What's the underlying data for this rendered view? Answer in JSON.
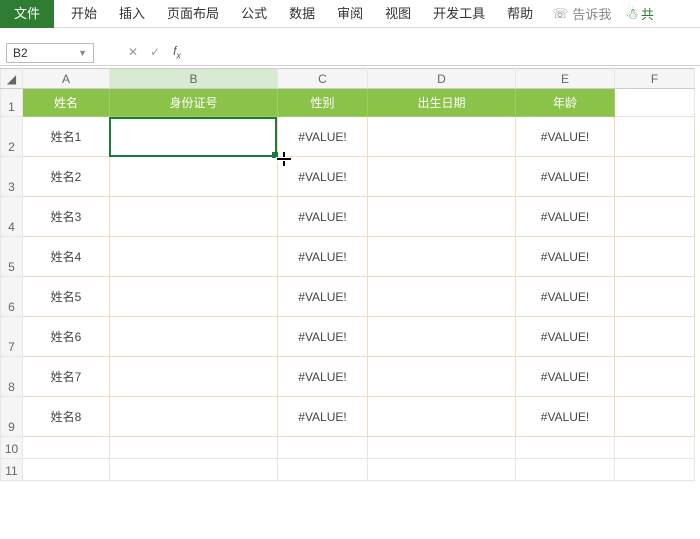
{
  "menu": {
    "file": "文件",
    "tabs": [
      "开始",
      "插入",
      "页面布局",
      "公式",
      "数据",
      "审阅",
      "视图",
      "开发工具",
      "帮助"
    ],
    "tell_me": "告诉我",
    "share": "共"
  },
  "formula_bar": {
    "name_box": "B2"
  },
  "columns": [
    "A",
    "B",
    "C",
    "D",
    "E",
    "F"
  ],
  "headers": {
    "A": "姓名",
    "B": "身份证号",
    "C": "性别",
    "D": "出生日期",
    "E": "年龄"
  },
  "rows": [
    {
      "n": "2",
      "A": "姓名1",
      "B": "",
      "C": "#VALUE!",
      "D": "",
      "E": "#VALUE!"
    },
    {
      "n": "3",
      "A": "姓名2",
      "B": "",
      "C": "#VALUE!",
      "D": "",
      "E": "#VALUE!"
    },
    {
      "n": "4",
      "A": "姓名3",
      "B": "",
      "C": "#VALUE!",
      "D": "",
      "E": "#VALUE!"
    },
    {
      "n": "5",
      "A": "姓名4",
      "B": "",
      "C": "#VALUE!",
      "D": "",
      "E": "#VALUE!"
    },
    {
      "n": "6",
      "A": "姓名5",
      "B": "",
      "C": "#VALUE!",
      "D": "",
      "E": "#VALUE!"
    },
    {
      "n": "7",
      "A": "姓名6",
      "B": "",
      "C": "#VALUE!",
      "D": "",
      "E": "#VALUE!"
    },
    {
      "n": "8",
      "A": "姓名7",
      "B": "",
      "C": "#VALUE!",
      "D": "",
      "E": "#VALUE!"
    },
    {
      "n": "9",
      "A": "姓名8",
      "B": "",
      "C": "#VALUE!",
      "D": "",
      "E": "#VALUE!"
    }
  ],
  "empty_rows": [
    "10",
    "11"
  ]
}
